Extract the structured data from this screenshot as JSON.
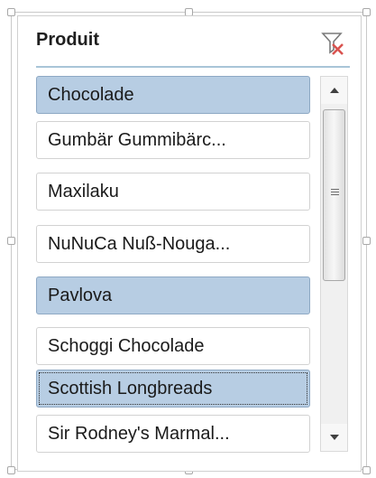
{
  "slicer": {
    "title": "Produit",
    "clear_filter_icon": "filter-clear-icon",
    "items": [
      {
        "label": "Chocolade",
        "selected": true
      },
      {
        "label": "Gumbär Gummibärc...",
        "selected": false
      },
      {
        "label": "Maxilaku",
        "selected": false
      },
      {
        "label": "NuNuCa Nuß-Nouga...",
        "selected": false
      },
      {
        "label": "Pavlova",
        "selected": true
      },
      {
        "label": "Schoggi Chocolade",
        "selected": false
      },
      {
        "label": "Scottish Longbreads",
        "selected": true,
        "focused": true
      },
      {
        "label": "Sir Rodney's Marmal...",
        "selected": false
      }
    ],
    "colors": {
      "selected_bg": "#b7cde3",
      "header_line": "#a9c5d8",
      "clear_filter_x": "#d9534f"
    }
  }
}
